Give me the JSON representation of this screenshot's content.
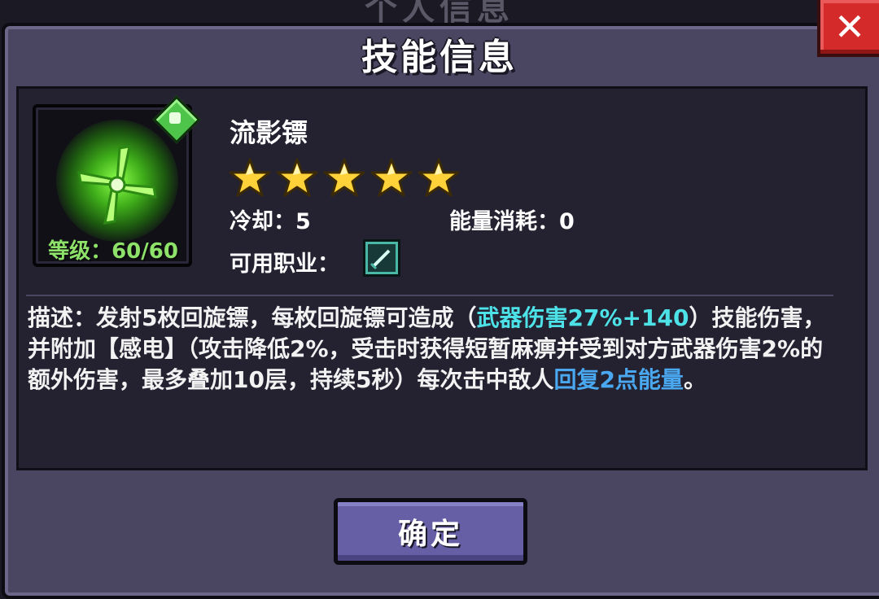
{
  "background_title": "个人信息",
  "dialog": {
    "title": "技能信息",
    "close_label": "✕",
    "confirm_label": "确定"
  },
  "skill": {
    "name": "流影镖",
    "icon": "green-swirl-shuriken-icon",
    "level_text": "等级：60/60",
    "stars": 5,
    "cooldown_label": "冷却：",
    "cooldown_value": "5",
    "energy_label": "能量消耗：",
    "energy_value": "0",
    "class_label": "可用职业：",
    "class_icon": "sword-class-icon"
  },
  "description": {
    "part1": "描述：发射5枚回旋镖，每枚回旋镖可造成（",
    "highlight1": "武器伤害27%+140",
    "part2": "）技能伤害，并附加【感电】（攻击降低2%，受击时获得短暂麻痹并受到对方武器伤害2%的额外伤害，最多叠加10层，持续5秒）每次击中敌人",
    "highlight2": "回复2点能量",
    "part3": "。"
  },
  "colors": {
    "panel": "#4a4662",
    "content": "#242231",
    "highlight_cyan": "#4de2e8",
    "highlight_blue": "#4aa8f0",
    "level_green": "#8ee26a",
    "close_red": "#d42a2a",
    "button_purple": "#665fa5"
  }
}
